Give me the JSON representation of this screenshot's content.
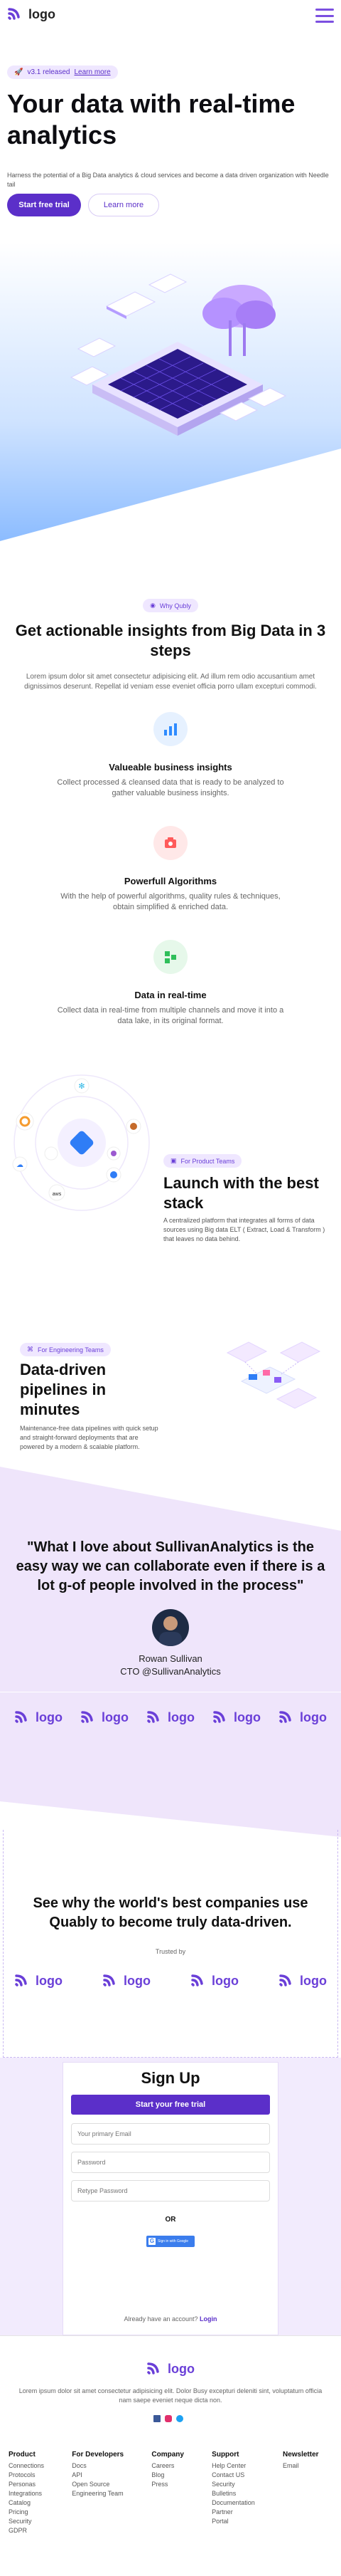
{
  "header": {
    "logo_text": "logo"
  },
  "hero": {
    "badge_version": "v3.1 released",
    "badge_link": "Learn more",
    "title": "Your data with real-time analytics",
    "subtitle": "Harness the potential of a Big Data analytics & cloud services and become a data driven organization with Needle tail",
    "cta_primary": "Start free trial",
    "cta_secondary": "Learn more"
  },
  "features": {
    "pill": "Why Qubly",
    "title": "Get actionable insights from Big Data in 3 steps",
    "description": "Lorem ipsum dolor sit amet consectetur adipisicing elit. Ad illum rem odio accusantium amet dignissimos deserunt. Repellat id veniam esse eveniet officia porro ullam excepturi commodi.",
    "items": [
      {
        "title": "Valueable business insights",
        "desc": "Collect processed & cleansed data that is ready to be analyzed to gather valuable business insights."
      },
      {
        "title": "Powerfull Algorithms",
        "desc": "With the help of powerful algorithms, quality rules & techniques, obtain simplified & enriched data."
      },
      {
        "title": "Data in real-time",
        "desc": "Collect data in real-time from multiple channels and move it into a data lake, in its original format."
      }
    ]
  },
  "product": {
    "pill": "For Product Teams",
    "title": "Launch with the best stack",
    "desc": "A centralized platform that integrates all forms of data sources using Big data ELT ( Extract, Load & Transform ) that leaves no data behind."
  },
  "engineering": {
    "pill": "For Engineering Teams",
    "title": "Data-driven pipelines in minutes",
    "desc": "Maintenance-free data pipelines with quick setup and straight-forward deployments that are powered by a modern & scalable platform."
  },
  "testimonial": {
    "quote": "\"What I love about SullivanAnalytics is the easy way we can collaborate even if there is a lot g-of people involved in the process\"",
    "name": "Rowan Sullivan",
    "role": "CTO @SullivanAnalytics",
    "logos": [
      "logo",
      "logo",
      "logo",
      "logo",
      "logo"
    ]
  },
  "trusted": {
    "title": "See why the world's best companies use Quably to become truly data-driven.",
    "label": "Trusted by",
    "logos": [
      "logo",
      "logo",
      "logo",
      "logo"
    ]
  },
  "signup": {
    "title": "Sign Up",
    "button": "Start your free trial",
    "email_placeholder": "Your primary Email",
    "password_placeholder": "Password",
    "retype_placeholder": "Retype Password",
    "or": "OR",
    "google_label": "Sign in with Google",
    "have_account": "Already have an account?",
    "login": "Login"
  },
  "footer": {
    "logo_text": "logo",
    "tagline": "Lorem ipsum dolor sit amet consectetur adipisicing elit. Dolor Busy excepturi deleniti sint, voluptatum officia nam saepe eveniet neque dicta non.",
    "columns": [
      {
        "title": "Product",
        "links": [
          "Connections",
          "Protocols",
          "Personas",
          "Integrations",
          "Catalog",
          "Pricing",
          "Security",
          "GDPR"
        ]
      },
      {
        "title": "For Developers",
        "links": [
          "Docs",
          "API",
          "Open Source",
          "Engineering Team"
        ]
      },
      {
        "title": "Company",
        "links": [
          "Careers",
          "Blog",
          "Press"
        ]
      },
      {
        "title": "Support",
        "links": [
          "Help Center",
          "Contact US",
          "Security",
          "Bulletins",
          "Documentation",
          "Partner",
          "Portal"
        ]
      },
      {
        "title": "Newsletter",
        "links": [
          "Email"
        ]
      }
    ]
  },
  "colors": {
    "brand": "#5b2fc9",
    "accent": "#7b4fe0",
    "lavender_bg": "#efe5fb"
  }
}
